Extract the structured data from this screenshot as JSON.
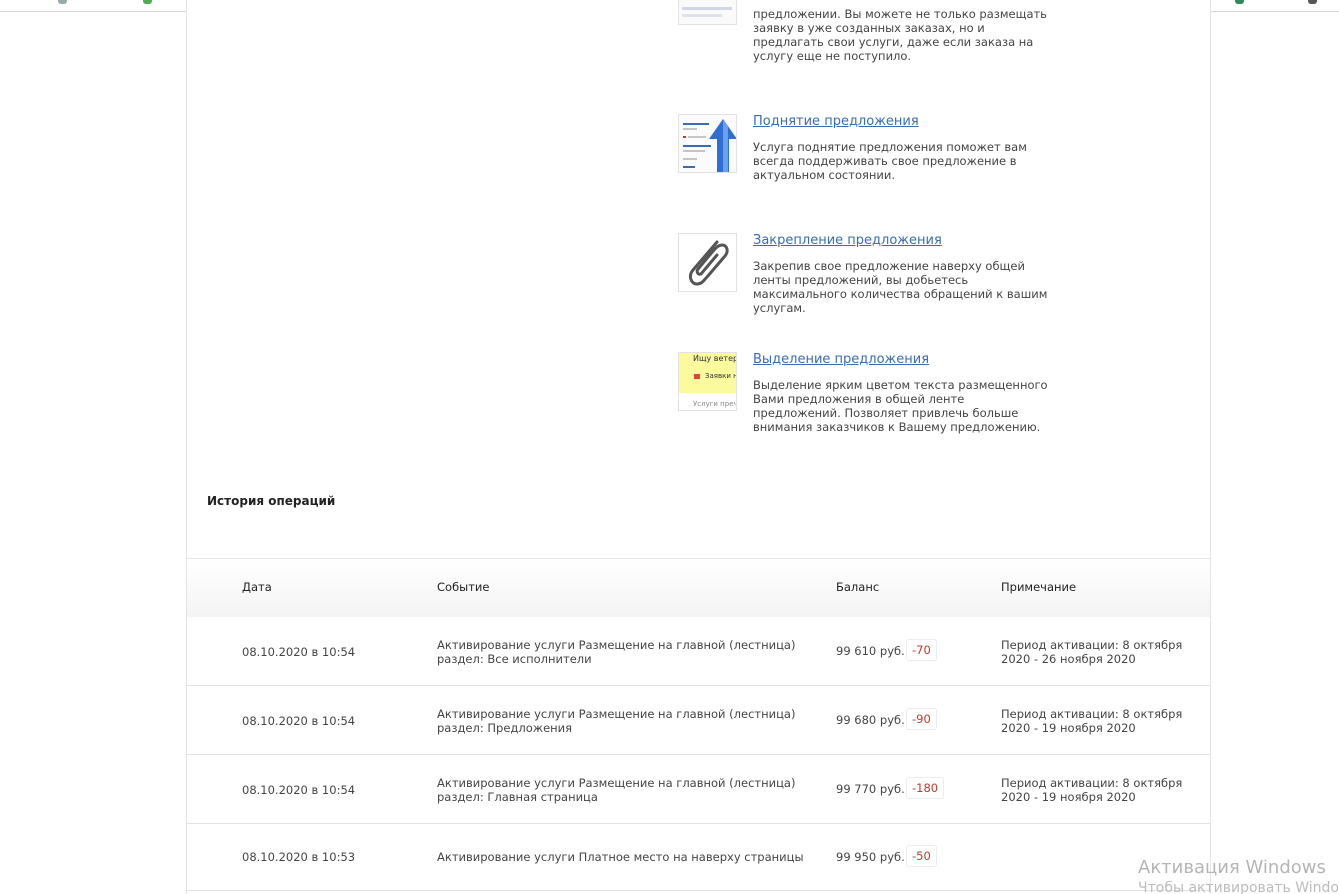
{
  "services": [
    {
      "id": "top",
      "title": "",
      "desc": "предложении. Вы можете не только размещать заявку в уже созданных заказах, но и предлагать свои услуги, даже если заказа на услугу еще не поступило.",
      "icon": "offer-thumb-icon"
    },
    {
      "id": "raise",
      "title": "Поднятие предложения",
      "desc": "Услуга поднятие предложения поможет вам всегда поддерживать свое предложение в актуальном состоянии.",
      "icon": "raise-arrow-icon"
    },
    {
      "id": "pin",
      "title": "Закрепление предложения",
      "desc": "Закрепив свое предложение наверху общей ленты предложений, вы добьетесь максимального количества обращений к вашим услугам.",
      "icon": "paperclip-icon"
    },
    {
      "id": "highlight",
      "title": "Выделение предложения",
      "desc": "Выделение ярким цветом текста размещенного Вами предложения в общей ленте предложений. Позволяет привлечь больше внимания заказчиков к Вашему предложению.",
      "icon": "highlight-thumb-icon",
      "thumb_text": [
        "Ищу ветерин",
        "Заявки н",
        "Услуги прече"
      ]
    }
  ],
  "history": {
    "title": "История операций",
    "columns": {
      "date": "Дата",
      "event": "Событие",
      "balance": "Баланс",
      "note": "Примечание"
    },
    "rows": [
      {
        "date": "08.10.2020 в 10:54",
        "event": "Активирование услуги Размещение на главной (лестница) раздел: Все исполнители",
        "balance": "99 610 руб.",
        "delta": "-70",
        "note": "Период активации: 8 октября 2020 - 26 ноября 2020"
      },
      {
        "date": "08.10.2020 в 10:54",
        "event": "Активирование услуги Размещение на главной (лестница) раздел: Предложения",
        "balance": "99 680 руб.",
        "delta": "-90",
        "note": "Период активации: 8 октября 2020 - 19 ноября 2020"
      },
      {
        "date": "08.10.2020 в 10:54",
        "event": "Активирование услуги Размещение на главной (лестница) раздел: Главная страница",
        "balance": "99 770 руб.",
        "delta": "-180",
        "note": "Период активации: 8 октября 2020 - 19 ноября 2020"
      },
      {
        "date": "08.10.2020 в 10:53",
        "event": "Активирование услуги Платное место на наверху страницы",
        "balance": "99 950 руб.",
        "delta": "-50",
        "note": ""
      }
    ]
  },
  "watermark": {
    "line1": "Активация Windows",
    "line2": "Чтобы активировать Windows"
  },
  "colors": {
    "link": "#3a6cb6",
    "negative": "#c0392b"
  }
}
